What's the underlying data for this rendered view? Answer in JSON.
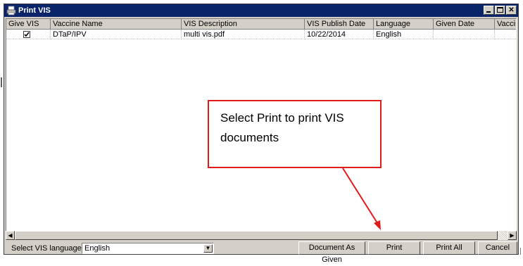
{
  "window": {
    "title": "Print VIS"
  },
  "grid": {
    "columns": [
      "Give VIS",
      "Vaccine Name",
      "VIS Description",
      "VIS Publish Date",
      "Language",
      "Given Date",
      "Vaccine"
    ],
    "rows": [
      {
        "give_vis": true,
        "vaccine_name": "DTaP/IPV",
        "vis_description": "multi vis.pdf",
        "publish_date": "10/22/2014",
        "language": "English",
        "given_date": "",
        "vaccine": ""
      }
    ]
  },
  "footer": {
    "language_label": "Select VIS language:",
    "language_value": "English",
    "buttons": {
      "document_as_given": "Document As Given",
      "print": "Print",
      "print_all": "Print All",
      "cancel": "Cancel"
    }
  },
  "callout": {
    "line1": "Select Print to print VIS",
    "line2": "documents"
  },
  "colors": {
    "titlebar": "#0a246a",
    "callout_border": "#e01b1b",
    "window_face": "#d4d0c8"
  }
}
